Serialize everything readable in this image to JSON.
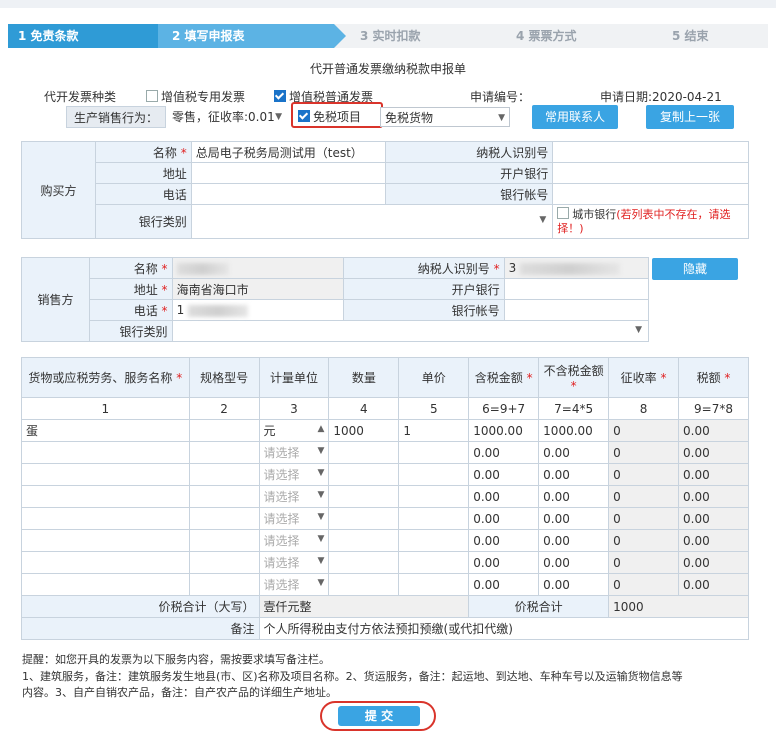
{
  "steps": [
    {
      "label": "1 免责条款"
    },
    {
      "label": "2 填写申报表"
    },
    {
      "label": "3 实时扣款"
    },
    {
      "label": "4 票票方式"
    },
    {
      "label": "5 结束"
    }
  ],
  "form_title": "代开普通发票缴纳税款申报单",
  "invoice_type": {
    "label": "代开发票种类",
    "special_label": "增值税专用发票",
    "normal_label": "增值税普通发票",
    "apply_no_label": "申请编号：",
    "apply_date": "申请日期:2020-04-21"
  },
  "sale_row": {
    "behavior_label": "生产销售行为：",
    "behavior_value": "零售，征收率:0.01",
    "exempt_label": "免税项目",
    "exempt_select": "免税货物",
    "contacts_button": "常用联系人",
    "copy_button": "复制上一张"
  },
  "buyer": {
    "section": "购买方",
    "name_label": "名称",
    "name_value": "总局电子税务局测试用（test）",
    "taxid_label": "纳税人识别号",
    "address_label": "地址",
    "bank_label": "开户银行",
    "phone_label": "电话",
    "account_label": "银行帐号",
    "bank_type_label": "银行类别",
    "city_bank_text": "城市银行",
    "city_bank_hint": "(若列表中不存在，请选择！)"
  },
  "seller": {
    "section": "销售方",
    "name_label": "名称",
    "taxid_label": "纳税人识别号",
    "taxid_value": "3",
    "hide_button": "隐藏",
    "address_label": "地址",
    "address_value": "海南省海口市",
    "bank_label": "开户银行",
    "phone_label": "电话",
    "phone_value": "1",
    "account_label": "银行帐号",
    "bank_type_label": "银行类别"
  },
  "items": {
    "headers": [
      "货物或应税劳务、服务名称",
      "规格型号",
      "计量单位",
      "数量",
      "单价",
      "含税金额",
      "不含税金额",
      "征收率",
      "税额"
    ],
    "index_row": [
      "1",
      "2",
      "3",
      "4",
      "5",
      "6=9+7",
      "7=4*5",
      "8",
      "9=7*8"
    ],
    "rows": [
      {
        "name": "蛋",
        "unit": "元",
        "qty": "1000",
        "price": "1",
        "incl": "1000.00",
        "excl": "1000.00",
        "rate": "0",
        "tax": "0.00"
      },
      {
        "unit": "请选择",
        "incl": "0.00",
        "excl": "0.00",
        "rate": "0",
        "tax": "0.00"
      },
      {
        "unit": "请选择",
        "incl": "0.00",
        "excl": "0.00",
        "rate": "0",
        "tax": "0.00"
      },
      {
        "unit": "请选择",
        "incl": "0.00",
        "excl": "0.00",
        "rate": "0",
        "tax": "0.00"
      },
      {
        "unit": "请选择",
        "incl": "0.00",
        "excl": "0.00",
        "rate": "0",
        "tax": "0.00"
      },
      {
        "unit": "请选择",
        "incl": "0.00",
        "excl": "0.00",
        "rate": "0",
        "tax": "0.00"
      },
      {
        "unit": "请选择",
        "incl": "0.00",
        "excl": "0.00",
        "rate": "0",
        "tax": "0.00"
      },
      {
        "unit": "请选择",
        "incl": "0.00",
        "excl": "0.00",
        "rate": "0",
        "tax": "0.00"
      }
    ],
    "total_upper_label": "价税合计（大写）",
    "total_upper_value": "壹仟元整",
    "total_label": "价税合计",
    "total_value": "1000",
    "remark_label": "备注",
    "remark_value": "个人所得税由支付方依法预扣预缴(或代扣代缴)"
  },
  "notes": [
    "提醒：如您开具的发票为以下服务内容，需按要求填写备注栏。",
    "1、建筑服务，备注：建筑服务发生地县(市、区)名称及项目名称。2、货运服务，备注：起运地、到达地、车种车号以及运输货物信息等",
    "内容。3、自产自销农产品，备注：自产农产品的详细生产地址。"
  ],
  "submit_label": "提 交",
  "colors": {
    "active_step": "#2f9bd6",
    "button": "#3aa4e3",
    "highlight": "#d9342b",
    "label_bg": "#eaf2fa"
  }
}
